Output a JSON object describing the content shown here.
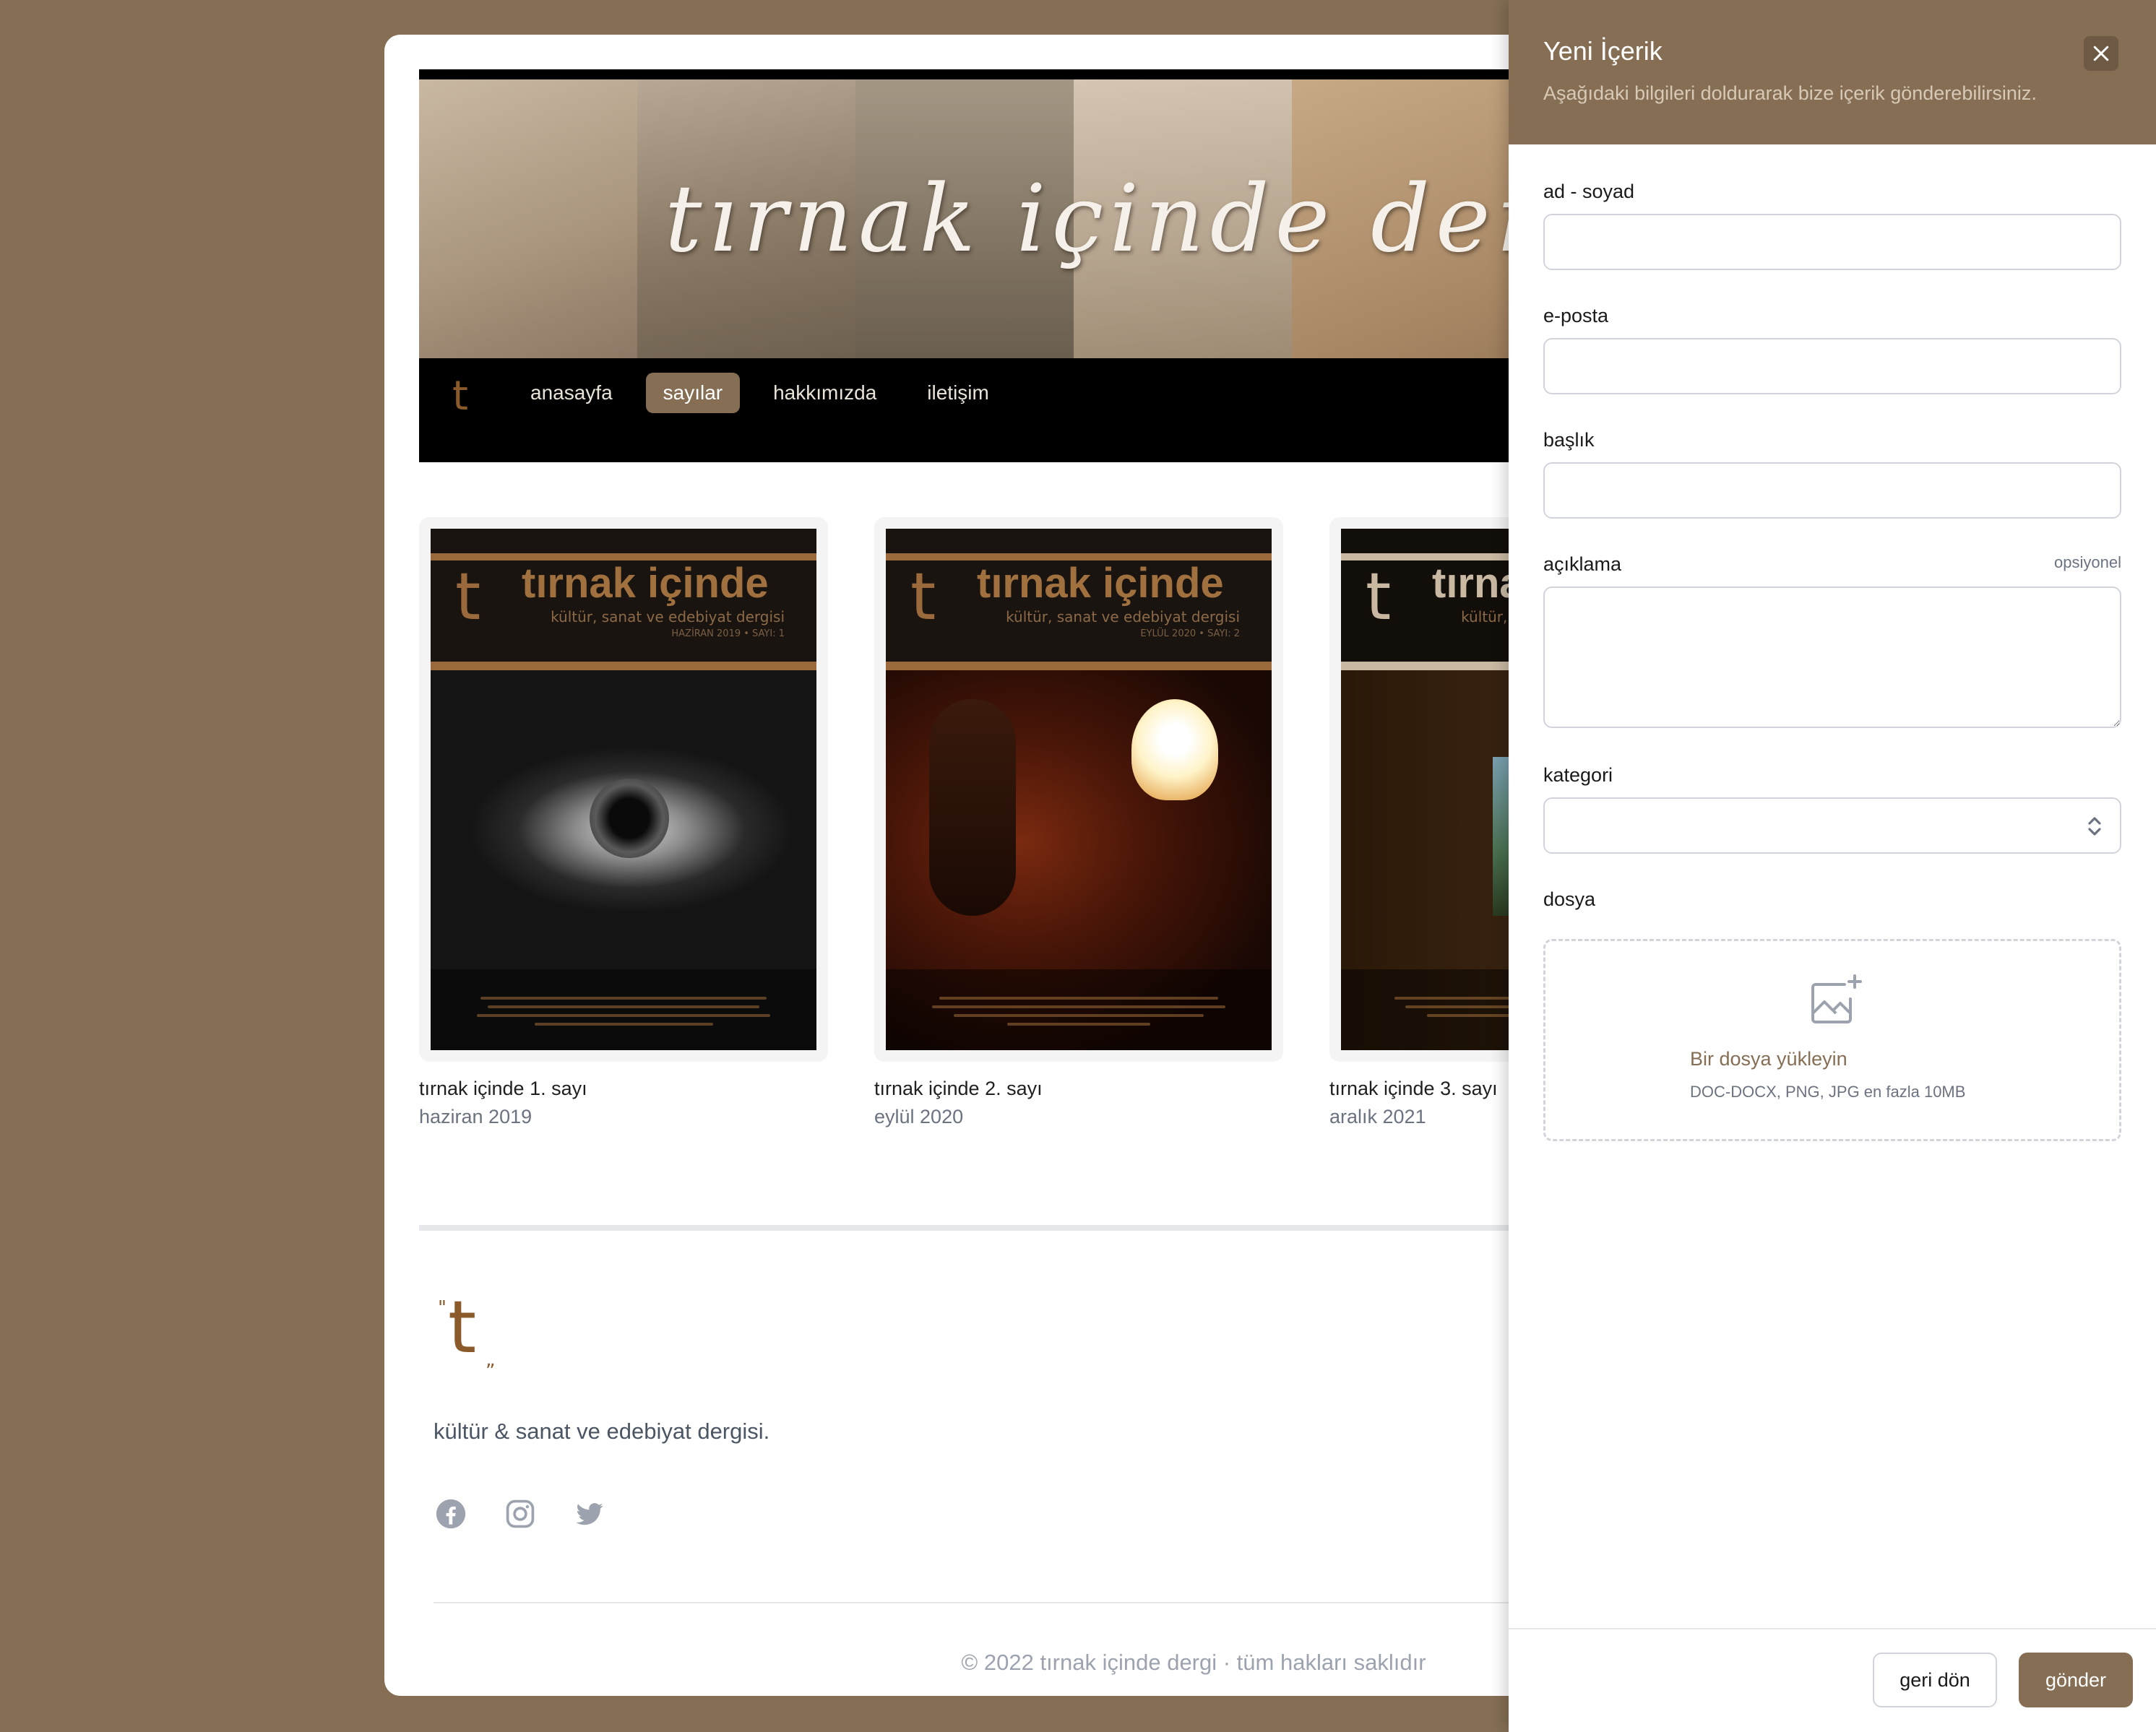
{
  "brand": {
    "banner_title": "tırnak içinde dergi",
    "logo_letter": "t",
    "logo_quote_open": "\"",
    "logo_quote_close": "„",
    "accent_color": "#856e54",
    "logo_color": "#8b5a2b"
  },
  "nav": {
    "items": [
      {
        "label": "anasayfa",
        "active": false
      },
      {
        "label": "sayılar",
        "active": true
      },
      {
        "label": "hakkımızda",
        "active": false
      },
      {
        "label": "iletişim",
        "active": false
      }
    ]
  },
  "issues": [
    {
      "title": "tırnak içinde 1. sayı",
      "date": "haziran 2019",
      "cover_title": "tırnak içinde",
      "cover_subtitle": "kültür, sanat ve edebiyat dergisi",
      "cover_meta": "HAZİRAN 2019 • SAYI: 1"
    },
    {
      "title": "tırnak içinde 2. sayı",
      "date": "eylül 2020",
      "cover_title": "tırnak içinde",
      "cover_subtitle": "kültür, sanat ve edebiyat dergisi",
      "cover_meta": "EYLÜL 2020 • SAYI: 2"
    },
    {
      "title": "tırnak içinde 3. sayı",
      "date": "aralık 2021",
      "cover_title": "tırnak içinde",
      "cover_subtitle": "kültür, sanat ve edebiyat dergisi",
      "cover_meta": ""
    }
  ],
  "footer": {
    "tagline": "kültür & sanat ve edebiyat dergisi.",
    "socials": [
      "facebook-icon",
      "instagram-icon",
      "twitter-icon"
    ],
    "copyright": "© 2022 tırnak içinde dergi · tüm hakları saklıdır"
  },
  "panel": {
    "title": "Yeni İçerik",
    "description": "Aşağıdaki bilgileri doldurarak bize içerik gönderebilirsiniz.",
    "fields": {
      "name_label": "ad - soyad",
      "name_value": "",
      "email_label": "e-posta",
      "email_value": "",
      "title_label": "başlık",
      "title_value": "",
      "description_label": "açıklama",
      "description_optional": "opsiyonel",
      "description_value": "",
      "category_label": "kategori",
      "category_value": "",
      "file_label": "dosya"
    },
    "upload": {
      "link_text": "Bir dosya yükleyin",
      "hint": "DOC-DOCX, PNG, JPG en fazla 10MB"
    },
    "buttons": {
      "back": "geri dön",
      "submit": "gönder"
    }
  }
}
